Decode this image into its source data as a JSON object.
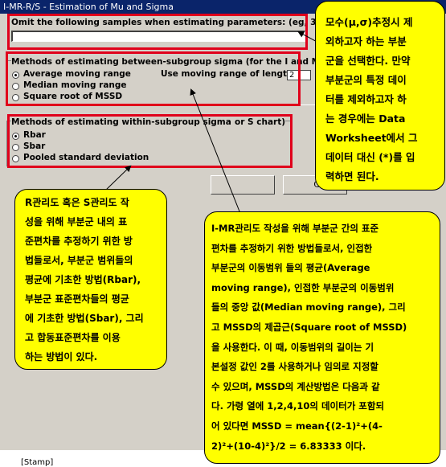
{
  "window": {
    "title": "I-MR-R/S - Estimation of Mu and Sigma"
  },
  "omit": {
    "label": "Omit the following samples when estimating parameters: (eg, 3 12:15)",
    "value": ""
  },
  "between": {
    "heading": "Methods of estimating between-subgroup sigma (for the I and MR charts)",
    "options": [
      {
        "label": "Average moving range",
        "selected": true
      },
      {
        "label": "Median moving range",
        "selected": false
      },
      {
        "label": "Square root of MSSD",
        "selected": false
      }
    ],
    "length_label": "Use moving range of length:",
    "length_value": "2"
  },
  "within": {
    "heading": "Methods of estimating within-subgroup sigma (for",
    "heading_tail": "or S chart)",
    "options": [
      {
        "label": "Rbar",
        "selected": true
      },
      {
        "label": "Sbar",
        "selected": false
      },
      {
        "label": "Pooled standard deviation",
        "selected": false
      }
    ]
  },
  "buttons": {
    "cancel": "Cance"
  },
  "callouts": {
    "omit_note": [
      "모수(μ,σ)추정시 제",
      "외하고자 하는 부분",
      "군을 선택한다. 만약",
      "부분군의 특정 데이",
      "터를 제외하고자 하",
      "는 경우에는 Data",
      "Worksheet에서 그",
      "데이터 대신 (*)를 입",
      "력하면 된다."
    ],
    "within_note": [
      "R관리도 혹은 S관리도 작",
      "성을 위해 부분군 내의 표",
      "준편차를 추정하기 위한 방",
      "법들로서, 부분군 범위들의",
      "평균에 기초한 방법(Rbar),",
      "부분군 표준편차들의 평균",
      "에 기초한 방법(Sbar), 그리",
      "고 합동표준편차를 이용",
      "하는 방법이 있다."
    ],
    "between_note": [
      "I-MR관리도 작성을 위해 부분군 간의 표준",
      "편차를 추정하기 위한 방법들로서, 인접한",
      "부분군의 이동범위 들의 평균(Average",
      "moving range), 인접한 부분군의 이동범위",
      "들의 중앙 값(Median moving range), 그리",
      "고 MSSD의 제곱근(Square root of MSSD)",
      "을 사용한다. 이 때, 이동범위의 길이는 기",
      "본설정 값인 2를 사용하거나 임의로 지정할",
      "수 있으며, MSSD의 계산방법은 다음과 같",
      "다. 가령 열에 1,2,4,10의 데이터가 포함되",
      "어 있다면 MSSD = mean{(2-1)²+(4-",
      "2)²+(10-4)²}/2 = 6.83333 이다."
    ]
  },
  "footer": {
    "stamp": "[Stamp]"
  },
  "colors": {
    "title_bar": "#0a246a",
    "highlight_box": "#e0001b",
    "callout": "#ffff00",
    "dialog_face": "#d4d0c8"
  }
}
